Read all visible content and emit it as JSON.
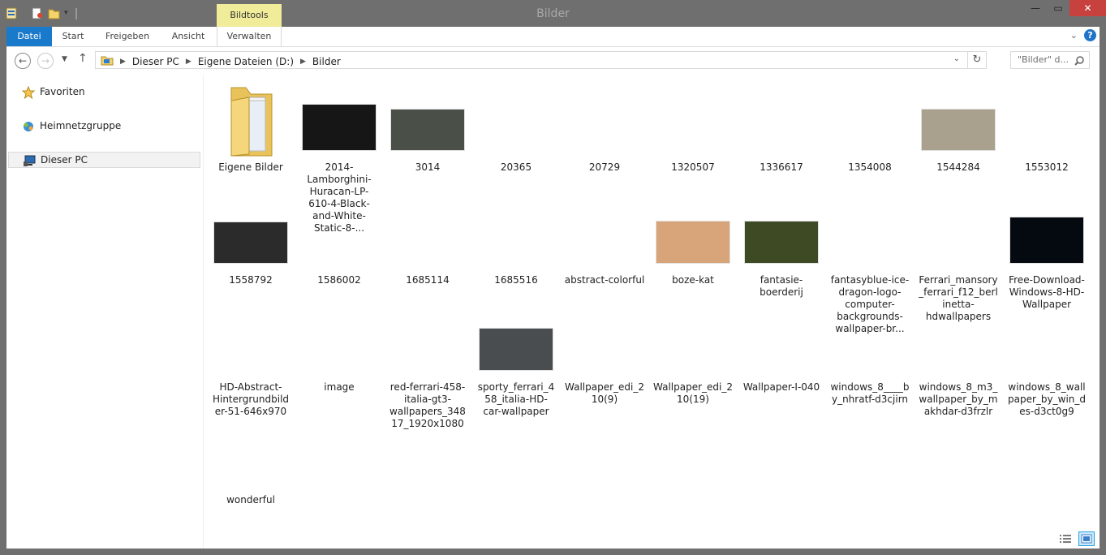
{
  "window": {
    "title": "Bilder"
  },
  "ribbon": {
    "context_group": "Bildtools",
    "tabs": [
      "Datei",
      "Start",
      "Freigeben",
      "Ansicht",
      "Verwalten"
    ]
  },
  "address": {
    "crumbs": [
      "Dieser PC",
      "Eigene Dateien (D:)",
      "Bilder"
    ],
    "search_placeholder": "\"Bilder\" d..."
  },
  "nav": {
    "items": [
      "Favoriten",
      "Heimnetzgruppe",
      "Dieser PC"
    ]
  },
  "files": [
    {
      "name": "Eigene Bilder",
      "type": "folder"
    },
    {
      "name": "2014-Lamborghini-Huracan-LP-610-4-Black-and-White-Static-8-...",
      "type": "image",
      "color": "#161616"
    },
    {
      "name": "3014",
      "type": "image",
      "color": "#4a5048"
    },
    {
      "name": "20365",
      "type": "blank"
    },
    {
      "name": "20729",
      "type": "blank"
    },
    {
      "name": "1320507",
      "type": "blank"
    },
    {
      "name": "1336617",
      "type": "blank"
    },
    {
      "name": "1354008",
      "type": "blank"
    },
    {
      "name": "1544284",
      "type": "image",
      "color": "#a9a08e"
    },
    {
      "name": "1553012",
      "type": "blank"
    },
    {
      "name": "1558792",
      "type": "image",
      "color": "#2b2b2b"
    },
    {
      "name": "1586002",
      "type": "blank"
    },
    {
      "name": "1685114",
      "type": "blank"
    },
    {
      "name": "1685516",
      "type": "blank"
    },
    {
      "name": "abstract-colorful",
      "type": "blank"
    },
    {
      "name": "boze-kat",
      "type": "image",
      "color": "#d8a47a"
    },
    {
      "name": "fantasie-boerderij",
      "type": "image",
      "color": "#3d4a23"
    },
    {
      "name": "fantasyblue-ice-dragon-logo-computer-backgrounds-wallpaper-br...",
      "type": "blank"
    },
    {
      "name": "Ferrari_mansory_ferrari_f12_berlinetta-hdwallpapers",
      "type": "blank"
    },
    {
      "name": "Free-Download-Windows-8-HD-Wallpaper",
      "type": "image",
      "color": "#050a10"
    },
    {
      "name": "HD-Abstract-Hintergrundbilder-51-646x970",
      "type": "blank"
    },
    {
      "name": "image",
      "type": "blank"
    },
    {
      "name": "red-ferrari-458-italia-gt3-wallpapers_34817_1920x1080",
      "type": "blank"
    },
    {
      "name": "sporty_ferrari_458_italia-HD-car-wallpaper",
      "type": "image",
      "color": "#4a4d50"
    },
    {
      "name": "Wallpaper_edi_210(9)",
      "type": "blank"
    },
    {
      "name": "Wallpaper_edi_210(19)",
      "type": "blank"
    },
    {
      "name": "Wallpaper-I-040",
      "type": "blank"
    },
    {
      "name": "windows_8____by_nhratf-d3cjirn",
      "type": "blank"
    },
    {
      "name": "windows_8_m3_wallpaper_by_makhdar-d3frzlr",
      "type": "blank"
    },
    {
      "name": "windows_8_wallpaper_by_win_des-d3ct0g9",
      "type": "blank"
    },
    {
      "name": "wonderful",
      "type": "blank"
    }
  ]
}
